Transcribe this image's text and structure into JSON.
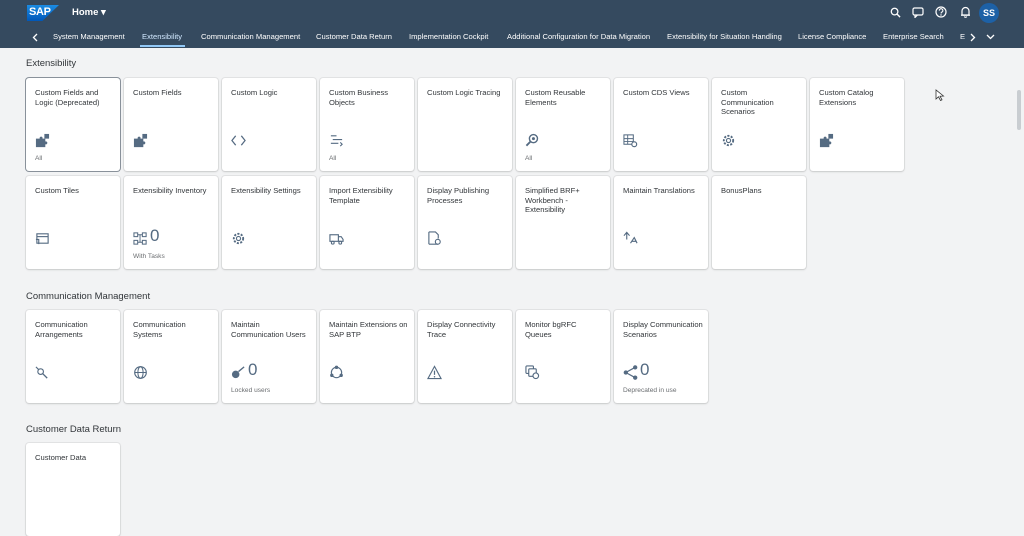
{
  "shell": {
    "logo": "SAP",
    "title": "Home ▾",
    "user_initials": "SS"
  },
  "nav": {
    "items": [
      "System Management",
      "Extensibility",
      "Communication Management",
      "Customer Data Return",
      "Implementation Cockpit",
      "Additional Configuration for Data Migration",
      "Extensibility for Situation Handling",
      "License Compliance",
      "Enterprise Search",
      "E"
    ]
  },
  "sections": [
    {
      "title": "Extensibility",
      "tiles": [
        {
          "title": "Custom Fields and Logic (Deprecated)",
          "icon": "puzzle-icon",
          "footer": "All"
        },
        {
          "title": "Custom Fields",
          "icon": "puzzle-icon",
          "footer": ""
        },
        {
          "title": "Custom Logic",
          "icon": "code-icon",
          "footer": ""
        },
        {
          "title": "Custom Business Objects",
          "icon": "list-icon",
          "footer": "All"
        },
        {
          "title": "Custom Logic Tracing",
          "icon": "",
          "footer": ""
        },
        {
          "title": "Custom Reusable Elements",
          "icon": "search-icon",
          "footer": "All"
        },
        {
          "title": "Custom CDS Views",
          "icon": "table-gear-icon",
          "footer": ""
        },
        {
          "title": "Custom Communication Scenarios",
          "icon": "gear-icon",
          "footer": ""
        },
        {
          "title": "Custom Catalog Extensions",
          "icon": "puzzle-icon",
          "footer": ""
        },
        {
          "title": "Custom Tiles",
          "icon": "window-icon",
          "footer": ""
        },
        {
          "title": "Extensibility Inventory",
          "icon": "hierarchy-icon",
          "number": "0",
          "footer": "With Tasks"
        },
        {
          "title": "Extensibility Settings",
          "icon": "gear-icon",
          "footer": ""
        },
        {
          "title": "Import Extensibility Template",
          "icon": "truck-icon",
          "footer": ""
        },
        {
          "title": "Display Publishing Processes",
          "icon": "document-gear-icon",
          "footer": ""
        },
        {
          "title": "Simplified BRF+ Workbench - Extensibility",
          "icon": "",
          "footer": ""
        },
        {
          "title": "Maintain Translations",
          "icon": "translate-icon",
          "footer": ""
        },
        {
          "title": "BonusPlans",
          "icon": "",
          "footer": ""
        }
      ]
    },
    {
      "title": "Communication Management",
      "tiles": [
        {
          "title": "Communication Arrangements",
          "icon": "connection-icon",
          "footer": ""
        },
        {
          "title": "Communication Systems",
          "icon": "globe-icon",
          "footer": ""
        },
        {
          "title": "Maintain Communication Users",
          "icon": "key-user-icon",
          "number": "0",
          "footer": "Locked users"
        },
        {
          "title": "Maintain Extensions on SAP BTP",
          "icon": "cycle-icon",
          "footer": ""
        },
        {
          "title": "Display Connectivity Trace",
          "icon": "warning-icon",
          "footer": ""
        },
        {
          "title": "Monitor bgRFC Queues",
          "icon": "queue-icon",
          "footer": ""
        },
        {
          "title": "Display Communication Scenarios",
          "icon": "share-icon",
          "number": "0",
          "footer": "Deprecated in use"
        }
      ]
    },
    {
      "title": "Customer Data Return",
      "tiles": [
        {
          "title": "Customer Data",
          "icon": "",
          "footer": ""
        }
      ]
    }
  ],
  "colors": {
    "shell": "#354a5f",
    "accent": "#0a6ed1",
    "background": "#f2f3f4"
  }
}
